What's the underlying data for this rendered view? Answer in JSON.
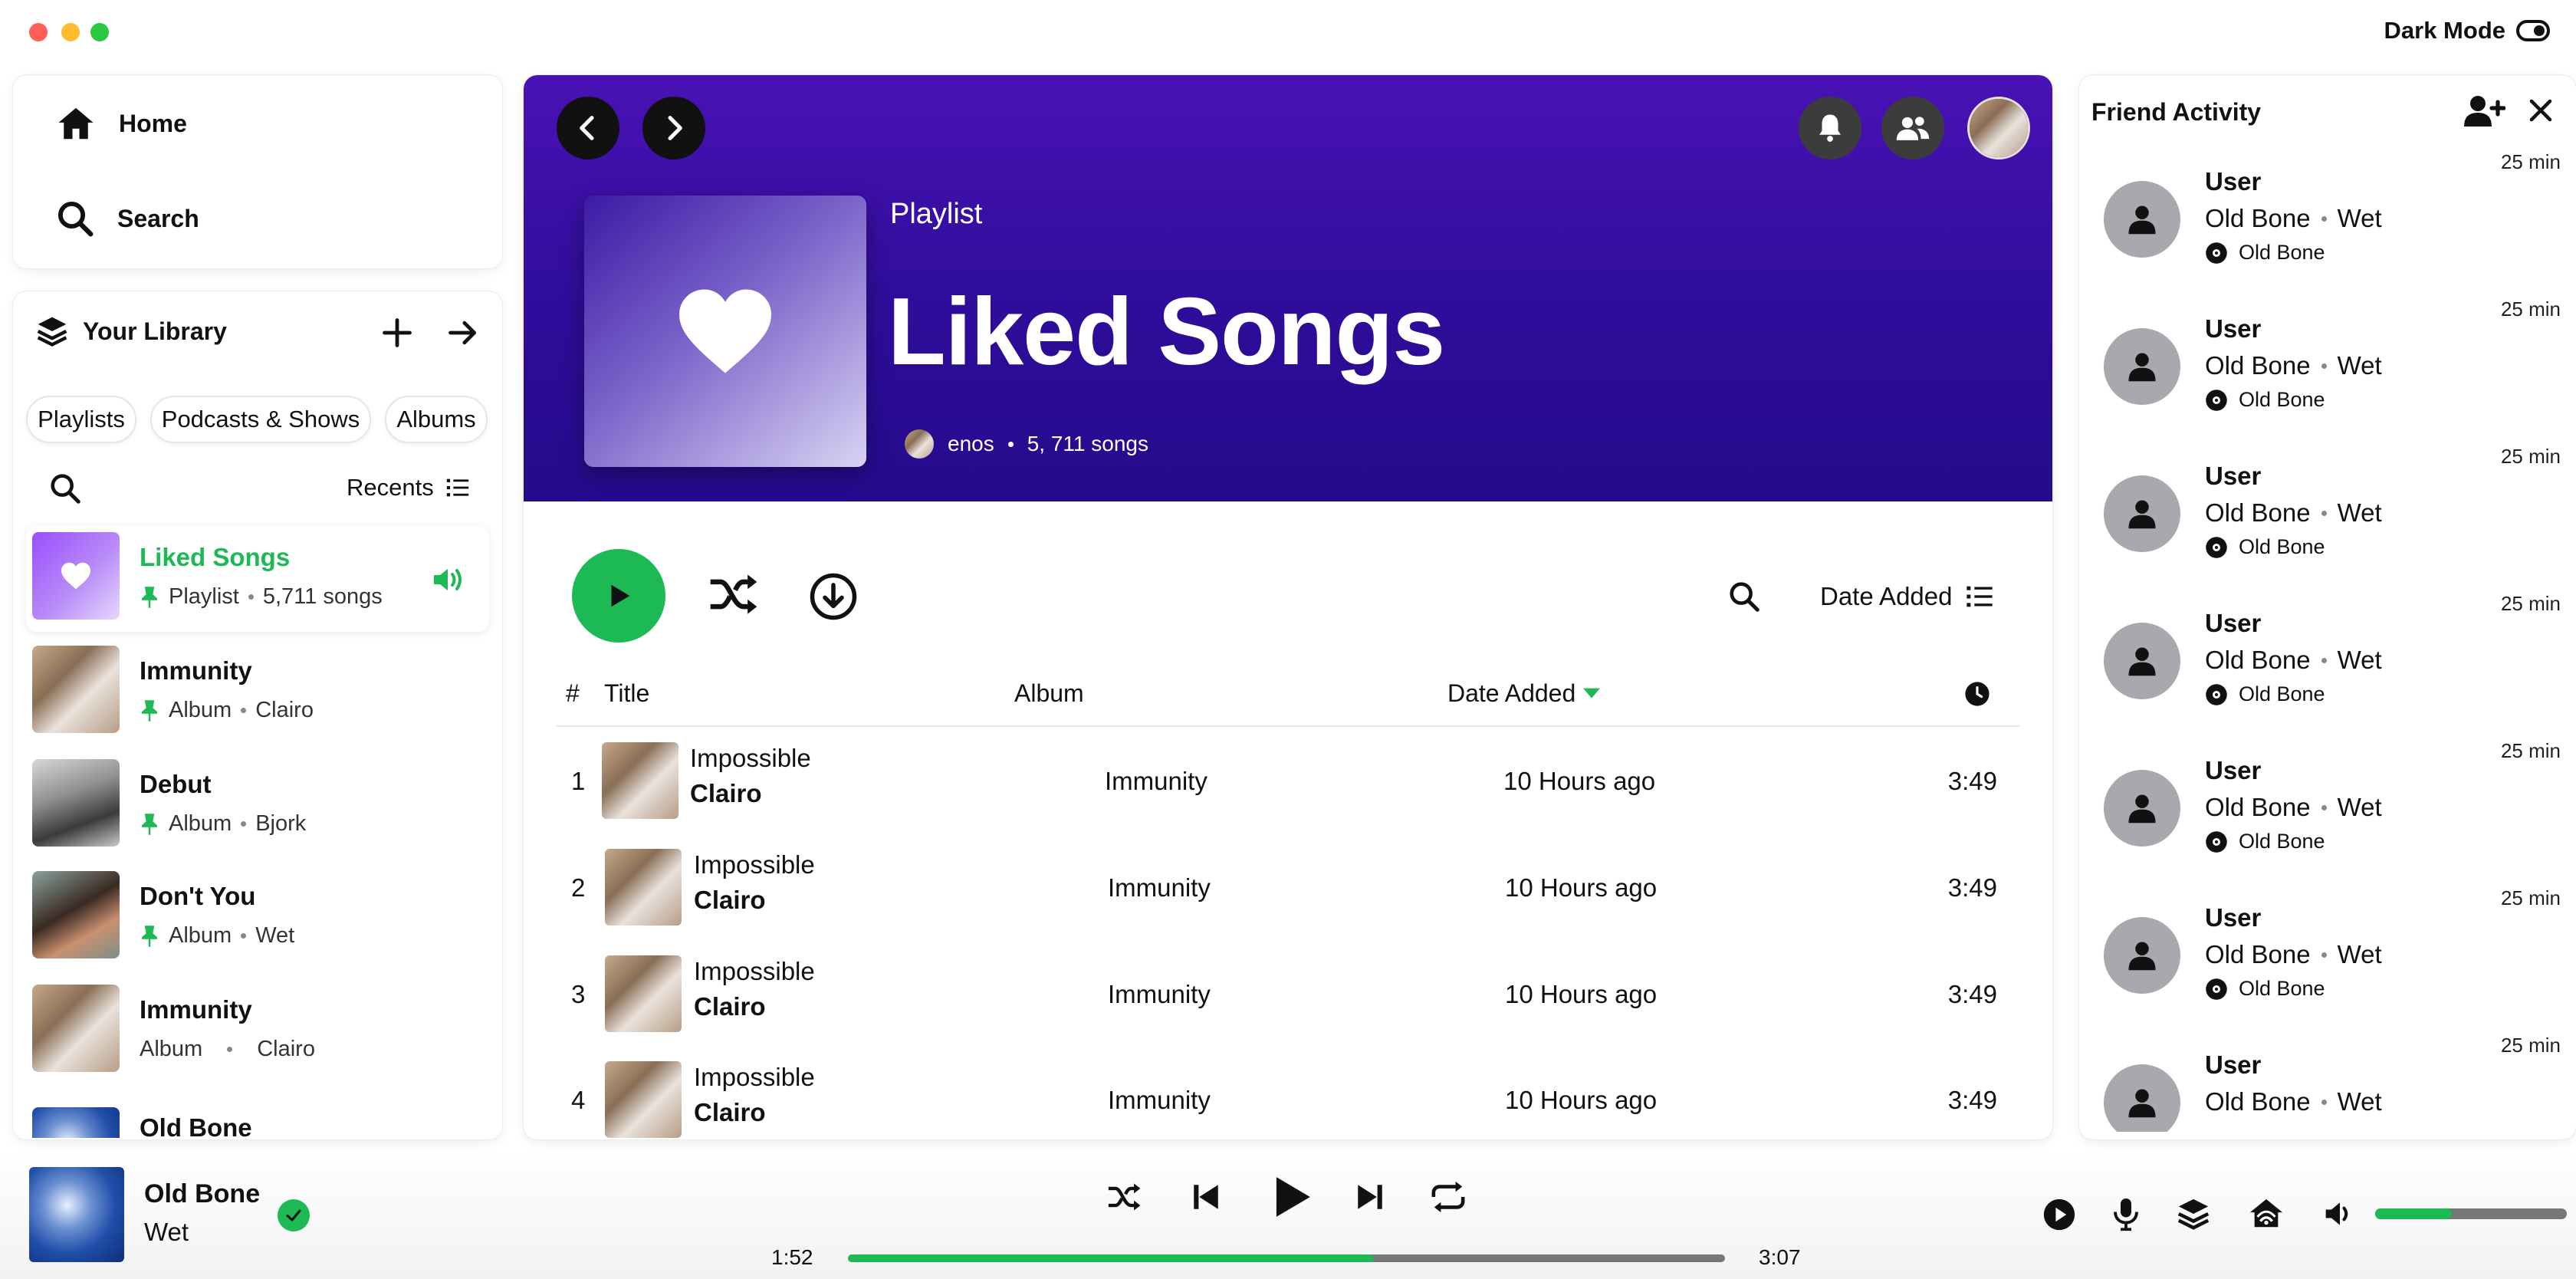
{
  "window": {
    "dark_mode_label": "Dark Mode"
  },
  "nav": {
    "home": "Home",
    "search": "Search"
  },
  "library": {
    "title": "Your Library",
    "filters": [
      "Playlists",
      "Podcasts & Shows",
      "Albums"
    ],
    "sort_label": "Recents",
    "items": [
      {
        "title": "Liked Songs",
        "type": "Playlist",
        "detail": "5,711 songs",
        "pinned": true
      },
      {
        "title": "Immunity",
        "type": "Album",
        "detail": "Clairo",
        "pinned": true
      },
      {
        "title": "Debut",
        "type": "Album",
        "detail": "Bjork",
        "pinned": true
      },
      {
        "title": "Don't You",
        "type": "Album",
        "detail": "Wet",
        "pinned": true
      },
      {
        "title": "Immunity",
        "type": "Album",
        "detail": "Clairo",
        "pinned": false
      },
      {
        "title": "Old Bone",
        "type": "",
        "detail": "",
        "pinned": false
      }
    ]
  },
  "header": {
    "kind": "Playlist",
    "title": "Liked Songs",
    "owner": "enos",
    "song_count": "5, 711 songs"
  },
  "controls": {
    "sort_label": "Date Added"
  },
  "table": {
    "columns": {
      "num": "#",
      "title": "Title",
      "album": "Album",
      "date": "Date Added"
    },
    "rows": [
      {
        "num": "1",
        "title": "Impossible",
        "artist": "Clairo",
        "album": "Immunity",
        "date": "10 Hours ago",
        "duration": "3:49"
      },
      {
        "num": "2",
        "title": "Impossible",
        "artist": "Clairo",
        "album": "Immunity",
        "date": "10 Hours ago",
        "duration": "3:49"
      },
      {
        "num": "3",
        "title": "Impossible",
        "artist": "Clairo",
        "album": "Immunity",
        "date": "10 Hours ago",
        "duration": "3:49"
      },
      {
        "num": "4",
        "title": "Impossible",
        "artist": "Clairo",
        "album": "Immunity",
        "date": "10 Hours ago",
        "duration": "3:49"
      }
    ]
  },
  "friends": {
    "title": "Friend Activity",
    "items": [
      {
        "name": "User",
        "song": "Old Bone",
        "artist": "Wet",
        "track": "Old Bone",
        "time": "25 min"
      },
      {
        "name": "User",
        "song": "Old Bone",
        "artist": "Wet",
        "track": "Old Bone",
        "time": "25 min"
      },
      {
        "name": "User",
        "song": "Old Bone",
        "artist": "Wet",
        "track": "Old Bone",
        "time": "25 min"
      },
      {
        "name": "User",
        "song": "Old Bone",
        "artist": "Wet",
        "track": "Old Bone",
        "time": "25 min"
      },
      {
        "name": "User",
        "song": "Old Bone",
        "artist": "Wet",
        "track": "Old Bone",
        "time": "25 min"
      },
      {
        "name": "User",
        "song": "Old Bone",
        "artist": "Wet",
        "track": "Old Bone",
        "time": "25 min"
      },
      {
        "name": "User",
        "song": "Old Bone",
        "artist": "Wet",
        "track": "",
        "time": "25 min"
      }
    ]
  },
  "player": {
    "title": "Old Bone",
    "artist": "Wet",
    "elapsed": "1:52",
    "total": "3:07",
    "progress_percent": 60,
    "volume_percent": 40
  },
  "colors": {
    "accent": "#1db954",
    "header_top": "#4a12b5",
    "header_bottom": "#250b8c"
  }
}
